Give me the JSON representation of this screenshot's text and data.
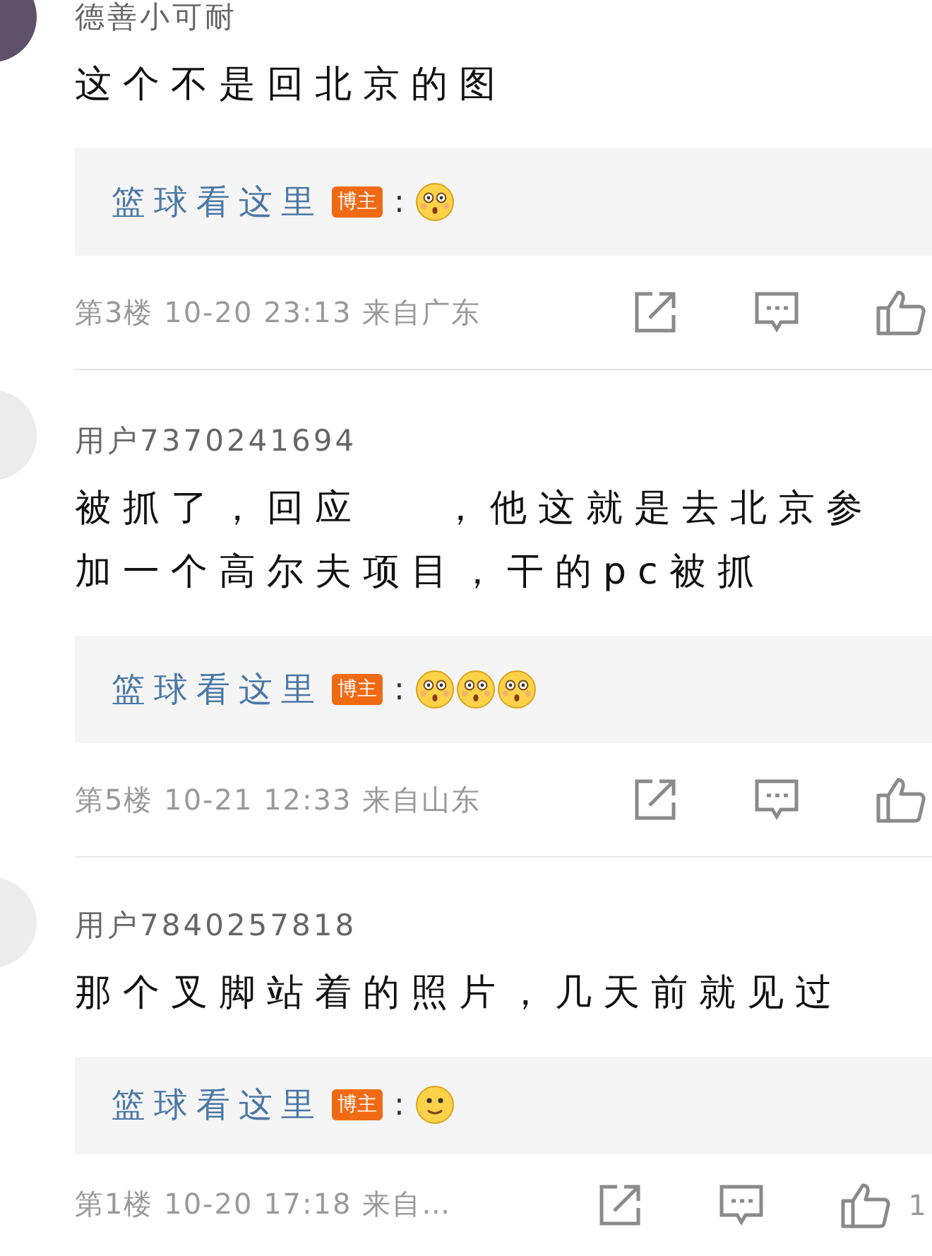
{
  "comments": [
    {
      "avatar": {
        "kind": "dark"
      },
      "user": "德善小可耐",
      "body": [
        "这个不是回北京的图"
      ],
      "reply": {
        "user": "篮球看这里",
        "badge": "博主",
        "colon": ":",
        "emojis": [
          {
            "kind": "shocked"
          }
        ]
      },
      "floor": "第3楼",
      "time": "10-20 23:13",
      "location": "来自广东"
    },
    {
      "avatar": {
        "kind": "light"
      },
      "user": "用户7370241694",
      "body": [
        "被抓了，回应",
        "，他这就是去北京参加一个高尔夫项目，干的pc被抓"
      ],
      "reply": {
        "user": "篮球看这里",
        "badge": "博主",
        "colon": ":",
        "emojis": [
          {
            "kind": "shocked"
          },
          {
            "kind": "shocked"
          },
          {
            "kind": "shocked"
          }
        ]
      },
      "floor": "第5楼",
      "time": "10-21 12:33",
      "location": "来自山东"
    },
    {
      "avatar": {
        "kind": "light"
      },
      "user": "用户7840257818",
      "body": [
        "那个叉脚站着的照片，几天前就见过"
      ],
      "reply": {
        "user": "篮球看这里",
        "badge": "博主",
        "colon": ":",
        "emojis": [
          {
            "kind": "smile"
          }
        ]
      },
      "floor": "第1楼",
      "time": "10-20 17:18",
      "location": "来自…",
      "likes": "1"
    }
  ]
}
